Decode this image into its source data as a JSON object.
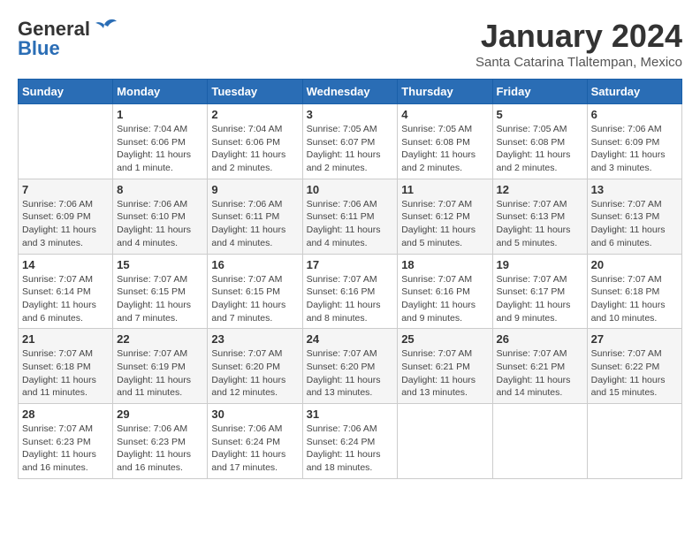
{
  "header": {
    "logo_general": "General",
    "logo_blue": "Blue",
    "month_title": "January 2024",
    "location": "Santa Catarina Tlaltempan, Mexico"
  },
  "weekdays": [
    "Sunday",
    "Monday",
    "Tuesday",
    "Wednesday",
    "Thursday",
    "Friday",
    "Saturday"
  ],
  "weeks": [
    [
      {
        "day": "",
        "info": ""
      },
      {
        "day": "1",
        "info": "Sunrise: 7:04 AM\nSunset: 6:06 PM\nDaylight: 11 hours\nand 1 minute."
      },
      {
        "day": "2",
        "info": "Sunrise: 7:04 AM\nSunset: 6:06 PM\nDaylight: 11 hours\nand 2 minutes."
      },
      {
        "day": "3",
        "info": "Sunrise: 7:05 AM\nSunset: 6:07 PM\nDaylight: 11 hours\nand 2 minutes."
      },
      {
        "day": "4",
        "info": "Sunrise: 7:05 AM\nSunset: 6:08 PM\nDaylight: 11 hours\nand 2 minutes."
      },
      {
        "day": "5",
        "info": "Sunrise: 7:05 AM\nSunset: 6:08 PM\nDaylight: 11 hours\nand 2 minutes."
      },
      {
        "day": "6",
        "info": "Sunrise: 7:06 AM\nSunset: 6:09 PM\nDaylight: 11 hours\nand 3 minutes."
      }
    ],
    [
      {
        "day": "7",
        "info": "Sunrise: 7:06 AM\nSunset: 6:09 PM\nDaylight: 11 hours\nand 3 minutes."
      },
      {
        "day": "8",
        "info": "Sunrise: 7:06 AM\nSunset: 6:10 PM\nDaylight: 11 hours\nand 4 minutes."
      },
      {
        "day": "9",
        "info": "Sunrise: 7:06 AM\nSunset: 6:11 PM\nDaylight: 11 hours\nand 4 minutes."
      },
      {
        "day": "10",
        "info": "Sunrise: 7:06 AM\nSunset: 6:11 PM\nDaylight: 11 hours\nand 4 minutes."
      },
      {
        "day": "11",
        "info": "Sunrise: 7:07 AM\nSunset: 6:12 PM\nDaylight: 11 hours\nand 5 minutes."
      },
      {
        "day": "12",
        "info": "Sunrise: 7:07 AM\nSunset: 6:13 PM\nDaylight: 11 hours\nand 5 minutes."
      },
      {
        "day": "13",
        "info": "Sunrise: 7:07 AM\nSunset: 6:13 PM\nDaylight: 11 hours\nand 6 minutes."
      }
    ],
    [
      {
        "day": "14",
        "info": "Sunrise: 7:07 AM\nSunset: 6:14 PM\nDaylight: 11 hours\nand 6 minutes."
      },
      {
        "day": "15",
        "info": "Sunrise: 7:07 AM\nSunset: 6:15 PM\nDaylight: 11 hours\nand 7 minutes."
      },
      {
        "day": "16",
        "info": "Sunrise: 7:07 AM\nSunset: 6:15 PM\nDaylight: 11 hours\nand 7 minutes."
      },
      {
        "day": "17",
        "info": "Sunrise: 7:07 AM\nSunset: 6:16 PM\nDaylight: 11 hours\nand 8 minutes."
      },
      {
        "day": "18",
        "info": "Sunrise: 7:07 AM\nSunset: 6:16 PM\nDaylight: 11 hours\nand 9 minutes."
      },
      {
        "day": "19",
        "info": "Sunrise: 7:07 AM\nSunset: 6:17 PM\nDaylight: 11 hours\nand 9 minutes."
      },
      {
        "day": "20",
        "info": "Sunrise: 7:07 AM\nSunset: 6:18 PM\nDaylight: 11 hours\nand 10 minutes."
      }
    ],
    [
      {
        "day": "21",
        "info": "Sunrise: 7:07 AM\nSunset: 6:18 PM\nDaylight: 11 hours\nand 11 minutes."
      },
      {
        "day": "22",
        "info": "Sunrise: 7:07 AM\nSunset: 6:19 PM\nDaylight: 11 hours\nand 11 minutes."
      },
      {
        "day": "23",
        "info": "Sunrise: 7:07 AM\nSunset: 6:20 PM\nDaylight: 11 hours\nand 12 minutes."
      },
      {
        "day": "24",
        "info": "Sunrise: 7:07 AM\nSunset: 6:20 PM\nDaylight: 11 hours\nand 13 minutes."
      },
      {
        "day": "25",
        "info": "Sunrise: 7:07 AM\nSunset: 6:21 PM\nDaylight: 11 hours\nand 13 minutes."
      },
      {
        "day": "26",
        "info": "Sunrise: 7:07 AM\nSunset: 6:21 PM\nDaylight: 11 hours\nand 14 minutes."
      },
      {
        "day": "27",
        "info": "Sunrise: 7:07 AM\nSunset: 6:22 PM\nDaylight: 11 hours\nand 15 minutes."
      }
    ],
    [
      {
        "day": "28",
        "info": "Sunrise: 7:07 AM\nSunset: 6:23 PM\nDaylight: 11 hours\nand 16 minutes."
      },
      {
        "day": "29",
        "info": "Sunrise: 7:06 AM\nSunset: 6:23 PM\nDaylight: 11 hours\nand 16 minutes."
      },
      {
        "day": "30",
        "info": "Sunrise: 7:06 AM\nSunset: 6:24 PM\nDaylight: 11 hours\nand 17 minutes."
      },
      {
        "day": "31",
        "info": "Sunrise: 7:06 AM\nSunset: 6:24 PM\nDaylight: 11 hours\nand 18 minutes."
      },
      {
        "day": "",
        "info": ""
      },
      {
        "day": "",
        "info": ""
      },
      {
        "day": "",
        "info": ""
      }
    ]
  ]
}
